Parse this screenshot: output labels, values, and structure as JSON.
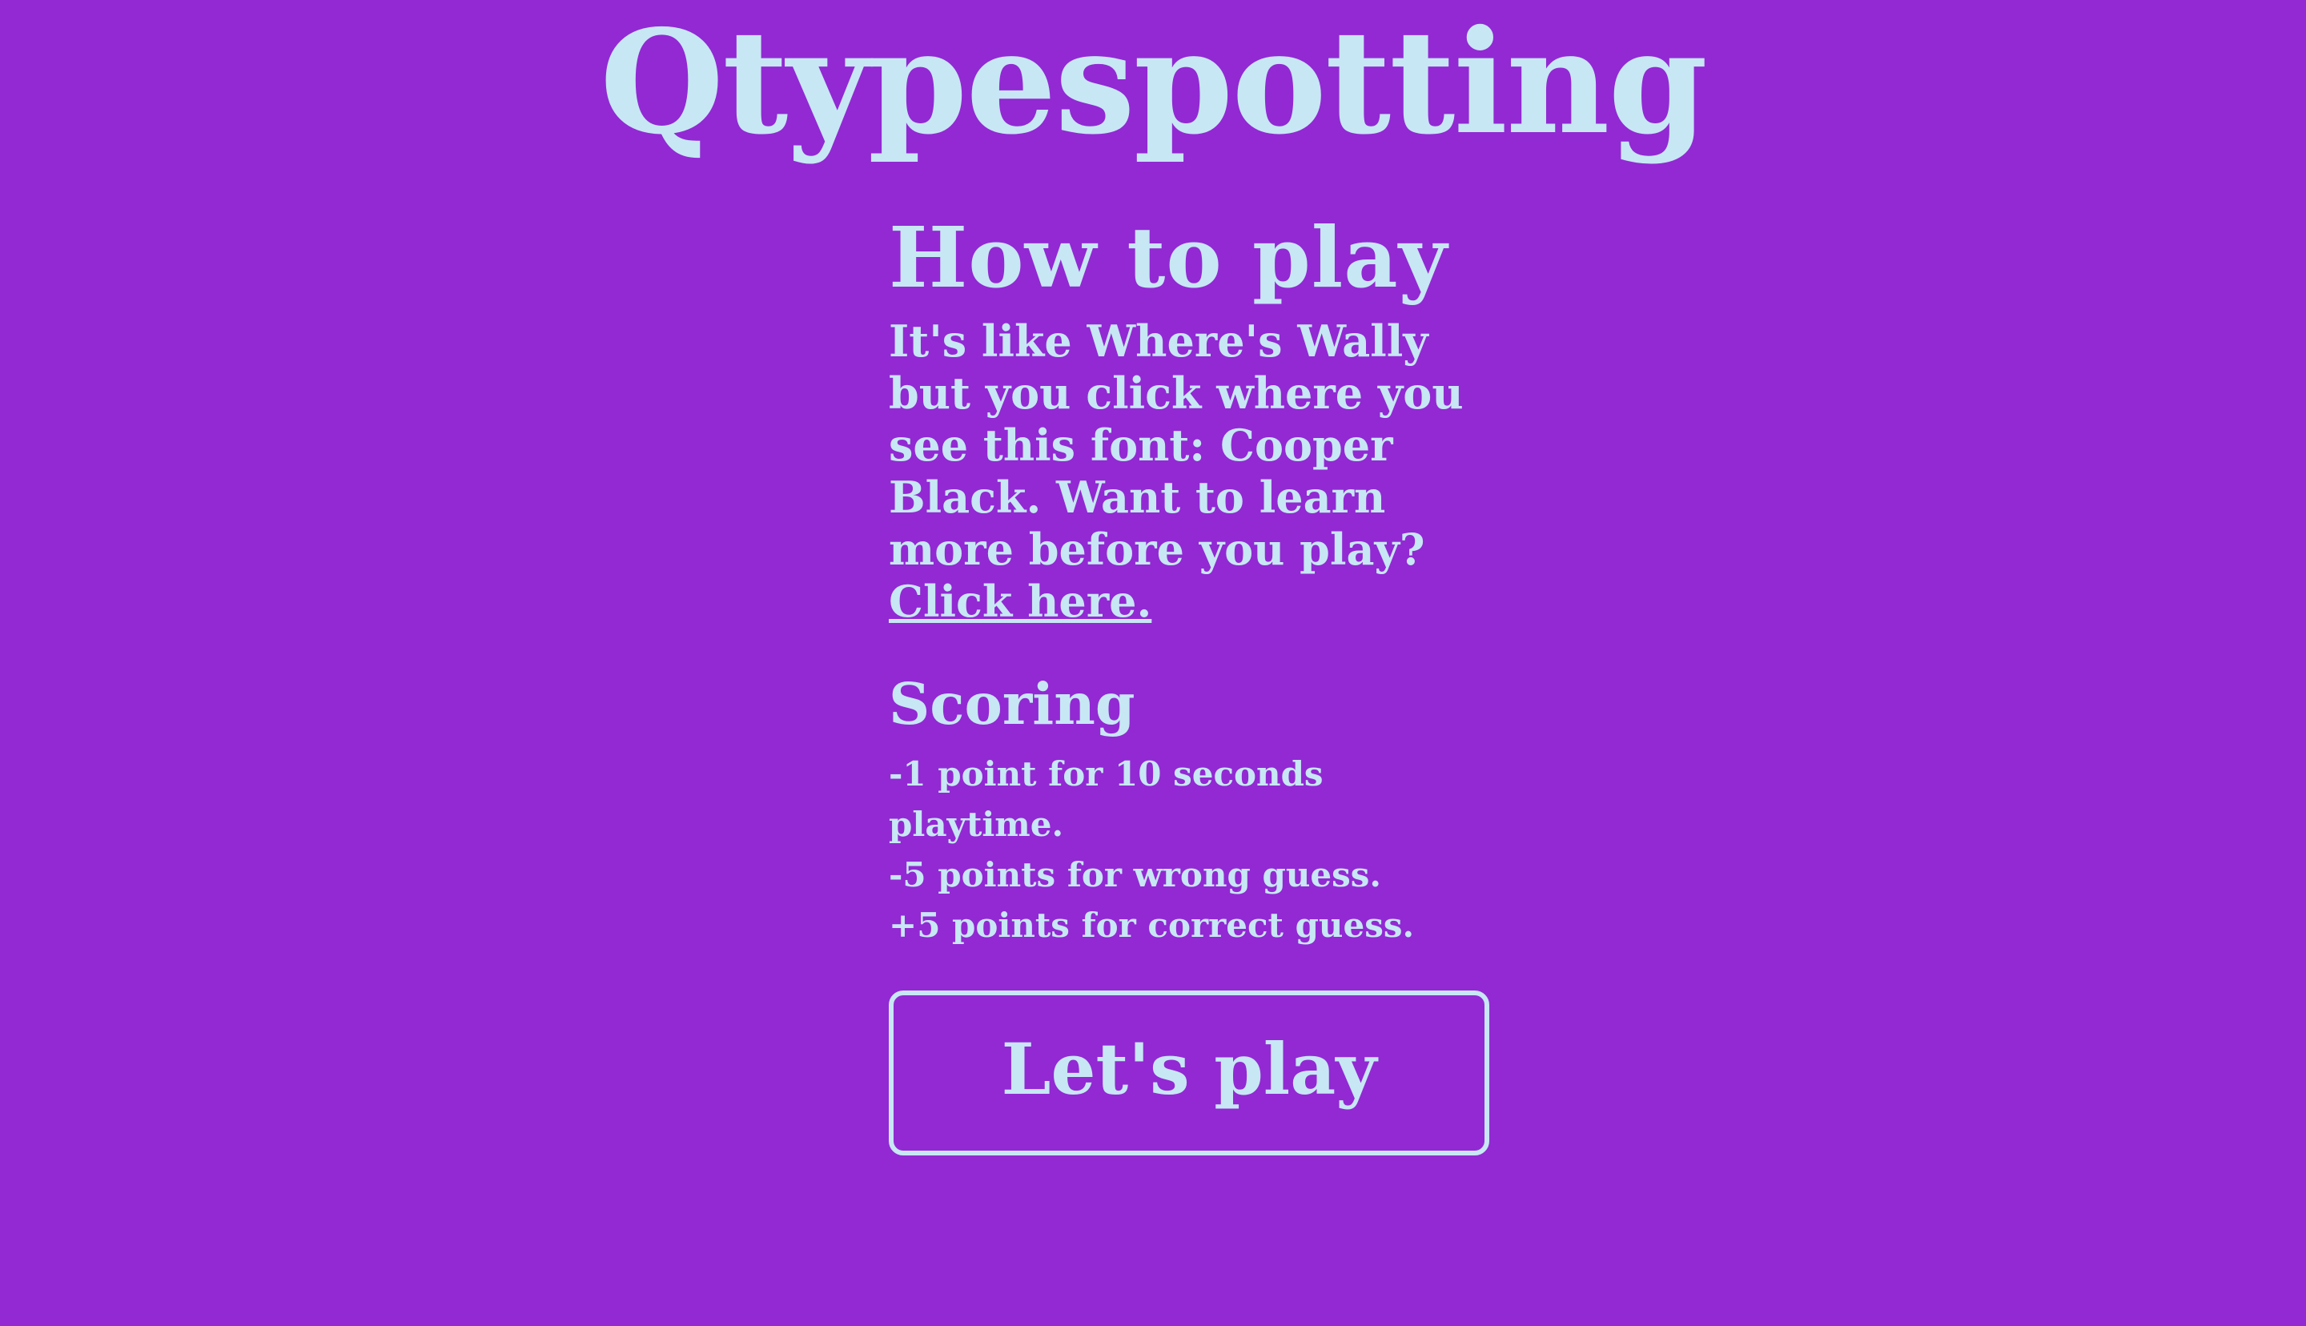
{
  "app": {
    "logo": "Qtypespotting"
  },
  "colors": {
    "background": "#9229d3",
    "text": "#c7e7f5"
  },
  "how_to_play": {
    "title": "How to play",
    "text": "It's like Where's Wally but you click where you see this font: Cooper Black. Want to learn more before you play?",
    "link_label": "Click here."
  },
  "scoring": {
    "title": "Scoring",
    "lines": [
      "-1 point for 10 seconds playtime.",
      "-5 points for wrong guess.",
      "+5 points for correct guess."
    ]
  },
  "play_button": {
    "label": "Let's play"
  }
}
